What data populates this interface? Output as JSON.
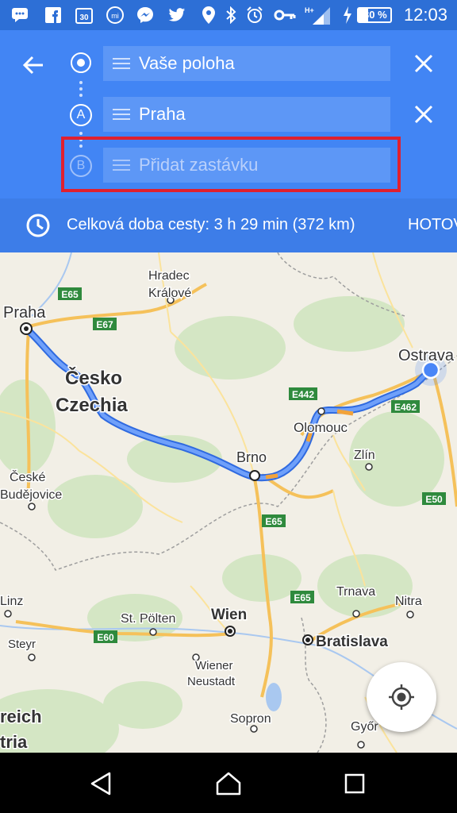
{
  "status_bar": {
    "time": "12:03",
    "battery": "30 %",
    "network": "H+",
    "icons": [
      "chat-icon",
      "facebook-icon",
      "calendar-30-icon",
      "mi-icon",
      "messenger-icon",
      "twitter-icon",
      "location-icon",
      "bluetooth-icon",
      "alarm-icon",
      "key-icon",
      "signal-icon",
      "battery-icon"
    ]
  },
  "directions": {
    "origin": "Vaše poloha",
    "stop_a": "Praha",
    "stop_b_placeholder": "Přidat zastávku",
    "marker_a": "A",
    "marker_b": "B"
  },
  "info_bar": {
    "summary": "Celková doba cesty: 3 h 29 min   (372 km)",
    "done_label": "HOTOVO"
  },
  "map": {
    "cities": {
      "praha": "Praha",
      "hradec": "Hradec",
      "kralove": "Králové",
      "ostrava": "Ostrava",
      "cesko": "Česko",
      "czechia": "Czechia",
      "olomouc": "Olomouc",
      "brno": "Brno",
      "zlin": "Zlín",
      "ceske": "České",
      "budejovice": "Budějovice",
      "linz": "Linz",
      "st_polten": "St. Pölten",
      "wien": "Wien",
      "bratislava": "Bratislava",
      "trnava": "Trnava",
      "nitra": "Nitra",
      "steyr": "Steyr",
      "wiener": "Wiener",
      "neustadt": "Neustadt",
      "reich": "reich",
      "tria": "tria",
      "sopron": "Sopron",
      "gyor": "Győr"
    },
    "roads": {
      "e65a": "E65",
      "e67": "E67",
      "e442": "E442",
      "e462": "E462",
      "e50": "E50",
      "e65b": "E65",
      "e65c": "E65",
      "e60": "E60"
    },
    "route_color": "#4a86f7"
  },
  "nav": {
    "back": "back-icon",
    "home": "home-icon",
    "recents": "recents-icon"
  }
}
